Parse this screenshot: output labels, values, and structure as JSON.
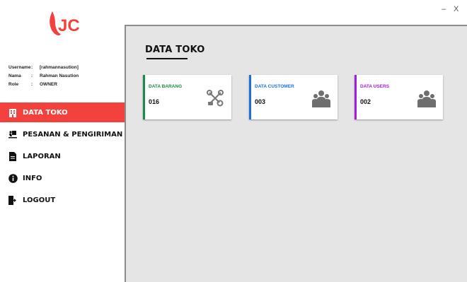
{
  "window": {
    "minimize": "–",
    "close": "X"
  },
  "brand": {
    "logo_text": "JC",
    "accent": "#f3413d"
  },
  "user": {
    "rows": [
      {
        "key": "Username",
        "sep": ":",
        "value": "[rahmannasution]"
      },
      {
        "key": "Nama",
        "sep": ":",
        "value": "Rahman Nasution"
      },
      {
        "key": "Role",
        "sep": ":",
        "value": "OWNER"
      }
    ]
  },
  "nav": [
    {
      "label": "DATA TOKO",
      "icon": "building-icon",
      "active": true
    },
    {
      "label": "PESANAN & PENGIRIMAN",
      "icon": "delivery-icon",
      "active": false
    },
    {
      "label": "LAPORAN",
      "icon": "document-icon",
      "active": false
    },
    {
      "label": "INFO",
      "icon": "info-icon",
      "active": false
    },
    {
      "label": "LOGOUT",
      "icon": "logout-icon",
      "active": false
    }
  ],
  "main": {
    "title": "DATA TOKO",
    "cards": [
      {
        "label": "DATA BARANG",
        "value": "016",
        "color": "#1e8a4a",
        "icon": "tools-icon"
      },
      {
        "label": "DATA CUSTOMER",
        "value": "003",
        "color": "#1b6fe0",
        "icon": "users-icon"
      },
      {
        "label": "DATA USERS",
        "value": "002",
        "color": "#a020d8",
        "icon": "users-icon"
      }
    ]
  }
}
